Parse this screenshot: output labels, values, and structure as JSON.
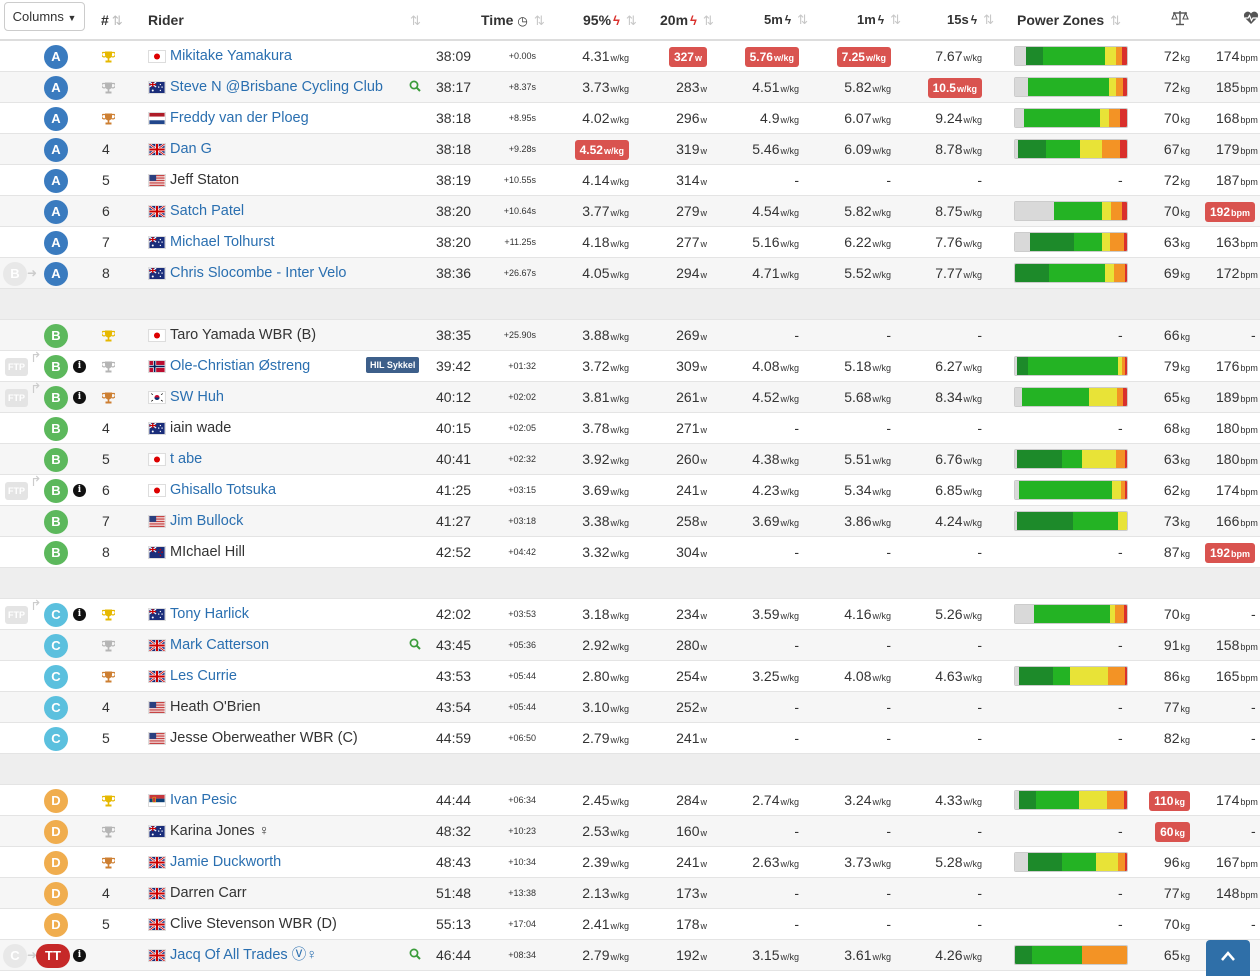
{
  "toolbar": {
    "columns_label": "Columns"
  },
  "headers": {
    "rank": "#",
    "rider": "Rider",
    "time": "Time",
    "p95": "95%",
    "p20m": "20m",
    "p5m": "5m",
    "p1m": "1m",
    "p15s": "15s",
    "zones": "Power Zones"
  },
  "colors": {
    "A": "#3a7bbf",
    "B": "#5cb85c",
    "C": "#5bc0de",
    "D": "#f0ad4e",
    "TT": "#c62828",
    "gold": "#e6b800",
    "silver": "#b5b5b5",
    "bronze": "#cd7f32",
    "z1": "#d9d9d9",
    "z2": "#1d8a2a",
    "z3": "#24b324",
    "z4": "#e8e337",
    "z5": "#f39325",
    "z6": "#d9302c",
    "link": "#2a6fb0",
    "highlight": "#d9534f"
  },
  "rows": [
    {
      "cat": "A",
      "pos": "",
      "trophy": "gold",
      "flag": "jp",
      "name": "Mikitake Yamakura",
      "link": true,
      "time": "38:09",
      "gap": "+0.00s",
      "p95": "4.31",
      "p20m": "327",
      "p20m_hl": true,
      "p5m": "5.76",
      "p5m_hl": true,
      "p1m": "7.25",
      "p1m_hl": true,
      "p15s": "7.67",
      "pz": [
        10,
        15,
        55,
        10,
        6,
        4
      ],
      "weight": "72",
      "hr": "174"
    },
    {
      "cat": "A",
      "pos": "",
      "trophy": "silver",
      "flag": "au",
      "name": "Steve N @Brisbane Cycling Club",
      "link": true,
      "search": true,
      "time": "38:17",
      "gap": "+8.37s",
      "p95": "3.73",
      "p20m": "283",
      "p5m": "4.51",
      "p1m": "5.82",
      "p15s": "10.5",
      "p15s_hl": true,
      "pz": [
        12,
        0,
        72,
        6,
        6,
        4
      ],
      "weight": "72",
      "hr": "185"
    },
    {
      "cat": "A",
      "pos": "",
      "trophy": "bronze",
      "flag": "nl",
      "name": "Freddy van der Ploeg",
      "link": true,
      "time": "38:18",
      "gap": "+8.95s",
      "p95": "4.02",
      "p20m": "296",
      "p5m": "4.9",
      "p1m": "6.07",
      "p15s": "9.24",
      "pz": [
        8,
        0,
        68,
        8,
        10,
        6
      ],
      "weight": "70",
      "hr": "168"
    },
    {
      "cat": "A",
      "pos": "4",
      "trophy": "",
      "flag": "gb",
      "name": "Dan G",
      "link": true,
      "time": "38:18",
      "gap": "+9.28s",
      "p95": "4.52",
      "p95_hl": true,
      "p20m": "319",
      "p5m": "5.46",
      "p1m": "6.09",
      "p15s": "8.78",
      "pz": [
        3,
        25,
        30,
        20,
        16,
        6
      ],
      "weight": "67",
      "hr": "179"
    },
    {
      "cat": "A",
      "pos": "5",
      "trophy": "",
      "flag": "us",
      "name": "Jeff Staton",
      "link": false,
      "time": "38:19",
      "gap": "+10.55s",
      "p95": "4.14",
      "p20m": "314",
      "p5m": "-",
      "p1m": "-",
      "p15s": "-",
      "pz": null,
      "weight": "72",
      "hr": "187"
    },
    {
      "cat": "A",
      "pos": "6",
      "trophy": "",
      "flag": "gb",
      "name": "Satch Patel",
      "link": true,
      "time": "38:20",
      "gap": "+10.64s",
      "p95": "3.77",
      "p20m": "279",
      "p5m": "4.54",
      "p1m": "5.82",
      "p15s": "8.75",
      "pz": [
        35,
        0,
        43,
        8,
        10,
        4
      ],
      "weight": "70",
      "hr": "192",
      "hr_hl": true
    },
    {
      "cat": "A",
      "pos": "7",
      "trophy": "",
      "flag": "au",
      "name": "Michael Tolhurst",
      "link": true,
      "time": "38:20",
      "gap": "+11.25s",
      "p95": "4.18",
      "p20m": "277",
      "p5m": "5.16",
      "p1m": "6.22",
      "p15s": "7.76",
      "pz": [
        13,
        40,
        25,
        7,
        12,
        3
      ],
      "weight": "63",
      "hr": "163"
    },
    {
      "cat": "A",
      "pos": "8",
      "trophy": "",
      "prev": "B",
      "flag": "au",
      "name": "Chris Slocombe - Inter Velo",
      "link": true,
      "time": "38:36",
      "gap": "+26.67s",
      "p95": "4.05",
      "p20m": "294",
      "p5m": "4.71",
      "p1m": "5.52",
      "p15s": "7.77",
      "pz": [
        0,
        30,
        50,
        8,
        10,
        2
      ],
      "weight": "69",
      "hr": "172"
    },
    {
      "sep": true
    },
    {
      "cat": "B",
      "pos": "",
      "trophy": "gold",
      "flag": "jp",
      "name": "Taro Yamada WBR (B)",
      "link": false,
      "time": "38:35",
      "gap": "+25.90s",
      "p95": "3.88",
      "p20m": "269",
      "p5m": "-",
      "p1m": "-",
      "p15s": "-",
      "pz": null,
      "weight": "66",
      "hr": "-"
    },
    {
      "cat": "B",
      "pos": "",
      "trophy": "silver",
      "ftp": true,
      "info": true,
      "flag": "no",
      "name": "Ole-Christian Østreng",
      "link": true,
      "team": "HIL Sykkel",
      "time": "39:42",
      "gap": "+01:32",
      "p95": "3.72",
      "p20m": "309",
      "p5m": "4.08",
      "p1m": "5.18",
      "p15s": "6.27",
      "pz": [
        2,
        10,
        80,
        4,
        2,
        2
      ],
      "weight": "79",
      "hr": "176"
    },
    {
      "cat": "B",
      "pos": "",
      "trophy": "bronze",
      "ftp": true,
      "info": true,
      "flag": "kr",
      "name": "SW Huh",
      "link": true,
      "time": "40:12",
      "gap": "+02:02",
      "p95": "3.81",
      "p20m": "261",
      "p5m": "4.52",
      "p1m": "5.68",
      "p15s": "8.34",
      "pz": [
        6,
        0,
        60,
        25,
        5,
        4
      ],
      "weight": "65",
      "hr": "189"
    },
    {
      "cat": "B",
      "pos": "4",
      "trophy": "",
      "flag": "au",
      "name": "iain wade",
      "link": false,
      "time": "40:15",
      "gap": "+02:05",
      "p95": "3.78",
      "p20m": "271",
      "p5m": "-",
      "p1m": "-",
      "p15s": "-",
      "pz": null,
      "weight": "68",
      "hr": "180"
    },
    {
      "cat": "B",
      "pos": "5",
      "trophy": "",
      "flag": "jp",
      "name": "t abe",
      "link": true,
      "time": "40:41",
      "gap": "+02:32",
      "p95": "3.92",
      "p20m": "260",
      "p5m": "4.38",
      "p1m": "5.51",
      "p15s": "6.76",
      "pz": [
        2,
        40,
        18,
        30,
        8,
        2
      ],
      "weight": "63",
      "hr": "180"
    },
    {
      "cat": "B",
      "pos": "6",
      "trophy": "",
      "ftp": true,
      "info": true,
      "flag": "jp",
      "name": "Ghisallo Totsuka",
      "link": true,
      "time": "41:25",
      "gap": "+03:15",
      "p95": "3.69",
      "p20m": "241",
      "p5m": "4.23",
      "p1m": "5.34",
      "p15s": "6.85",
      "pz": [
        4,
        0,
        83,
        8,
        3,
        2
      ],
      "weight": "62",
      "hr": "174"
    },
    {
      "cat": "B",
      "pos": "7",
      "trophy": "",
      "flag": "us",
      "name": "Jim Bullock",
      "link": true,
      "time": "41:27",
      "gap": "+03:18",
      "p95": "3.38",
      "p20m": "258",
      "p5m": "3.69",
      "p1m": "3.86",
      "p15s": "4.24",
      "pz": [
        2,
        50,
        40,
        8,
        0,
        0
      ],
      "weight": "73",
      "hr": "166"
    },
    {
      "cat": "B",
      "pos": "8",
      "trophy": "",
      "flag": "nz",
      "name": "MIchael Hill",
      "link": false,
      "time": "42:52",
      "gap": "+04:42",
      "p95": "3.32",
      "p20m": "304",
      "p5m": "-",
      "p1m": "-",
      "p15s": "-",
      "pz": null,
      "weight": "87",
      "hr": "192",
      "hr_hl": true
    },
    {
      "sep": true
    },
    {
      "cat": "C",
      "pos": "",
      "trophy": "gold",
      "ftp": true,
      "info": true,
      "flag": "au",
      "name": "Tony Harlick",
      "link": true,
      "time": "42:02",
      "gap": "+03:53",
      "p95": "3.18",
      "p20m": "234",
      "p5m": "3.59",
      "p1m": "4.16",
      "p15s": "5.26",
      "pz": [
        17,
        0,
        68,
        4,
        8,
        3
      ],
      "weight": "70",
      "hr": "-"
    },
    {
      "cat": "C",
      "pos": "",
      "trophy": "silver",
      "flag": "gb",
      "name": "Mark Catterson",
      "link": true,
      "search": true,
      "time": "43:45",
      "gap": "+05:36",
      "p95": "2.92",
      "p20m": "280",
      "p5m": "-",
      "p1m": "-",
      "p15s": "-",
      "pz": null,
      "weight": "91",
      "hr": "158"
    },
    {
      "cat": "C",
      "pos": "",
      "trophy": "bronze",
      "flag": "gb",
      "name": "Les Currie",
      "link": true,
      "time": "43:53",
      "gap": "+05:44",
      "p95": "2.80",
      "p20m": "254",
      "p5m": "3.25",
      "p1m": "4.08",
      "p15s": "4.63",
      "pz": [
        4,
        30,
        15,
        34,
        15,
        2
      ],
      "weight": "86",
      "hr": "165"
    },
    {
      "cat": "C",
      "pos": "4",
      "trophy": "",
      "flag": "us",
      "name": "Heath O'Brien",
      "link": false,
      "time": "43:54",
      "gap": "+05:44",
      "p95": "3.10",
      "p20m": "252",
      "p5m": "-",
      "p1m": "-",
      "p15s": "-",
      "pz": null,
      "weight": "77",
      "hr": "-"
    },
    {
      "cat": "C",
      "pos": "5",
      "trophy": "",
      "flag": "us",
      "name": "Jesse Oberweather WBR (C)",
      "link": false,
      "time": "44:59",
      "gap": "+06:50",
      "p95": "2.79",
      "p20m": "241",
      "p5m": "-",
      "p1m": "-",
      "p15s": "-",
      "pz": null,
      "weight": "82",
      "hr": "-"
    },
    {
      "sep": true
    },
    {
      "cat": "D",
      "pos": "",
      "trophy": "gold",
      "flag": "rs",
      "name": "Ivan Pesic",
      "link": true,
      "time": "44:44",
      "gap": "+06:34",
      "p95": "2.45",
      "p20m": "284",
      "p5m": "2.74",
      "p1m": "3.24",
      "p15s": "4.33",
      "pz": [
        4,
        15,
        38,
        25,
        15,
        3
      ],
      "weight": "110",
      "weight_hl": true,
      "hr": "174"
    },
    {
      "cat": "D",
      "pos": "",
      "trophy": "silver",
      "flag": "au",
      "name": "Karina Jones ♀",
      "link": false,
      "time": "48:32",
      "gap": "+10:23",
      "p95": "2.53",
      "p20m": "160",
      "p5m": "-",
      "p1m": "-",
      "p15s": "-",
      "pz": null,
      "weight": "60",
      "weight_hl": true,
      "hr": "-"
    },
    {
      "cat": "D",
      "pos": "",
      "trophy": "bronze",
      "flag": "gb",
      "name": "Jamie Duckworth",
      "link": true,
      "time": "48:43",
      "gap": "+10:34",
      "p95": "2.39",
      "p20m": "241",
      "p5m": "2.63",
      "p1m": "3.73",
      "p15s": "5.28",
      "pz": [
        12,
        30,
        30,
        20,
        6,
        2
      ],
      "weight": "96",
      "hr": "167"
    },
    {
      "cat": "D",
      "pos": "4",
      "trophy": "",
      "flag": "gb",
      "name": "Darren Carr",
      "link": false,
      "time": "51:48",
      "gap": "+13:38",
      "p95": "2.13",
      "p20m": "173",
      "p5m": "-",
      "p1m": "-",
      "p15s": "-",
      "pz": null,
      "weight": "77",
      "hr": "148"
    },
    {
      "cat": "D",
      "pos": "5",
      "trophy": "",
      "flag": "gb",
      "name": "Clive Stevenson WBR (D)",
      "link": false,
      "time": "55:13",
      "gap": "+17:04",
      "p95": "2.41",
      "p20m": "178",
      "p5m": "-",
      "p1m": "-",
      "p15s": "-",
      "pz": null,
      "weight": "70",
      "hr": "-"
    },
    {
      "cat": "TT",
      "pos": "",
      "trophy": "",
      "prev": "C",
      "info": true,
      "flag": "gb",
      "name": "Jacq Of All Trades Ⓥ♀",
      "link": true,
      "search": true,
      "time": "46:44",
      "gap": "+08:34",
      "p95": "2.79",
      "p20m": "192",
      "p5m": "3.15",
      "p1m": "3.61",
      "p15s": "4.26",
      "pz": [
        0,
        15,
        45,
        0,
        40,
        0
      ],
      "weight": "65",
      "hr": ""
    }
  ],
  "units": {
    "wkg": "w/kg",
    "w": "w",
    "kg": "kg",
    "bpm": "bpm"
  },
  "scroll_top_icon": "chevron-up-icon"
}
